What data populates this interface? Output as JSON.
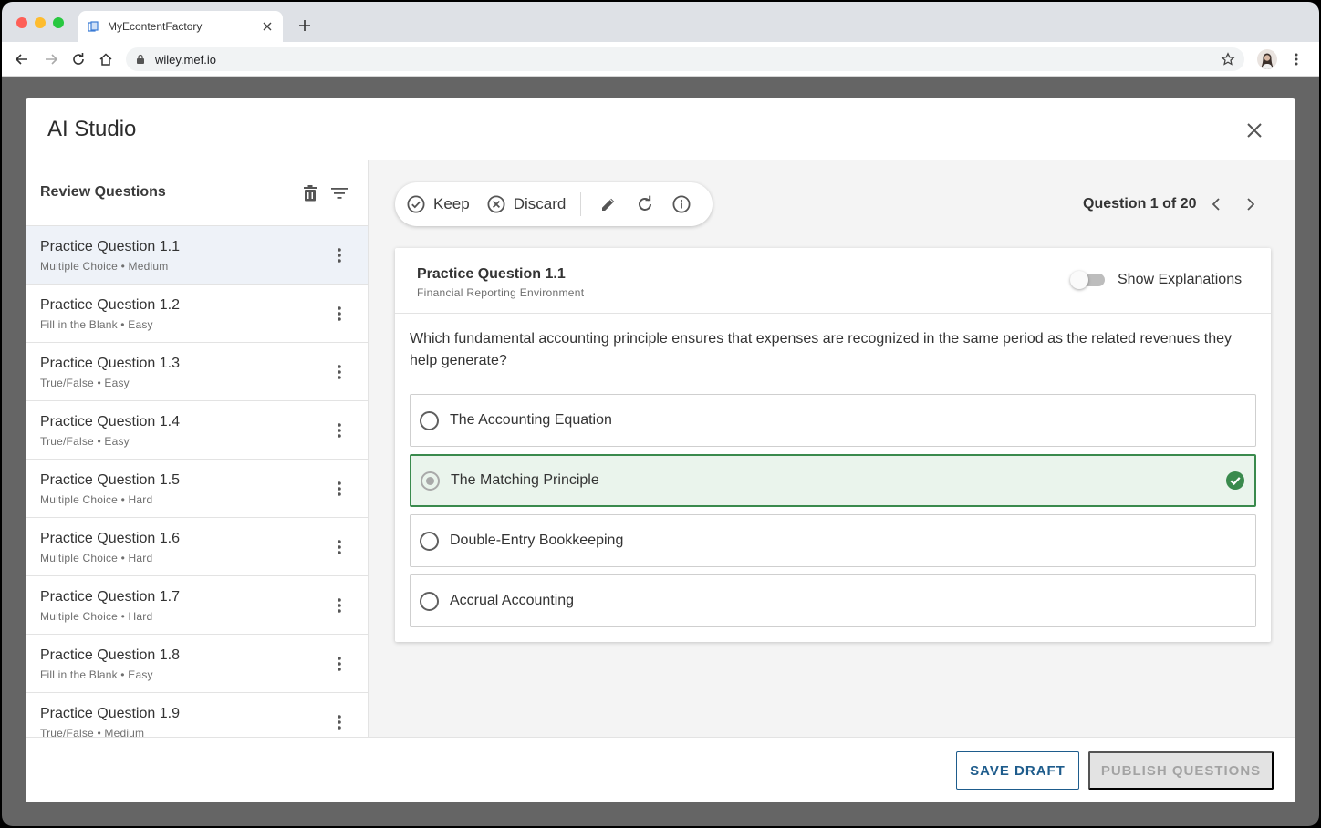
{
  "browser": {
    "tab_title": "MyEcontentFactory",
    "url": "wiley.mef.io"
  },
  "modal": {
    "title": "AI Studio"
  },
  "sidebar": {
    "title": "Review Questions",
    "items": [
      {
        "title": "Practice Question 1.1",
        "meta": "Multiple Choice • Medium"
      },
      {
        "title": "Practice Question 1.2",
        "meta": "Fill in the Blank • Easy"
      },
      {
        "title": "Practice Question 1.3",
        "meta": "True/False • Easy"
      },
      {
        "title": "Practice Question 1.4",
        "meta": "True/False • Easy"
      },
      {
        "title": "Practice Question 1.5",
        "meta": "Multiple Choice • Hard"
      },
      {
        "title": "Practice Question 1.6",
        "meta": "Multiple Choice • Hard"
      },
      {
        "title": "Practice Question 1.7",
        "meta": "Multiple Choice • Hard"
      },
      {
        "title": "Practice Question 1.8",
        "meta": "Fill in the Blank • Easy"
      },
      {
        "title": "Practice Question 1.9",
        "meta": "True/False • Medium"
      }
    ]
  },
  "actions": {
    "keep": "Keep",
    "discard": "Discard"
  },
  "pager": {
    "text": "Question 1 of 20"
  },
  "question": {
    "title": "Practice Question 1.1",
    "subtitle": "Financial Reporting Environment",
    "toggle_label": "Show Explanations",
    "text": "Which fundamental accounting principle ensures that expenses are recognized in the same period as the related revenues they help generate?",
    "answers": [
      {
        "label": "The Accounting Equation",
        "correct": false
      },
      {
        "label": "The Matching Principle",
        "correct": true
      },
      {
        "label": "Double-Entry Bookkeeping",
        "correct": false
      },
      {
        "label": "Accrual Accounting",
        "correct": false
      }
    ]
  },
  "footer": {
    "save_label": "SAVE DRAFT",
    "publish_label": "PUBLISH QUESTIONS"
  },
  "colors": {
    "accent": "#1e5c8c",
    "correct": "#3a8a4d",
    "active_row": "#eef2f8"
  }
}
